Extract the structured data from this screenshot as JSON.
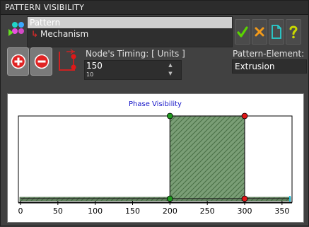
{
  "window": {
    "title": "PATTERN VISIBILITY"
  },
  "tree": {
    "items": [
      {
        "label": "Pattern"
      },
      {
        "label": "Mechanism"
      }
    ]
  },
  "toolbar": {
    "ok_icon": "check-icon",
    "cancel_icon": "x-icon",
    "new_icon": "document-icon",
    "help_icon": "question-icon",
    "ok_color": "#5ad400",
    "cancel_color": "#f29a1a",
    "new_color": "#28d0d0",
    "help_color": "#c8d800"
  },
  "timing": {
    "label": "Node's Timing: [ Units ]",
    "value": "150",
    "step": "10"
  },
  "pattern_element": {
    "label": "Pattern-Element:",
    "value": "Extrusion"
  },
  "chart_data": {
    "type": "area",
    "title": "Phase Visibility",
    "x_ticks": [
      0,
      50,
      100,
      150,
      200,
      250,
      300,
      350
    ],
    "xlim": [
      0,
      360
    ],
    "ylim": [
      0,
      1
    ],
    "series": [
      {
        "points": [
          [
            0,
            0
          ],
          [
            200,
            0
          ],
          [
            200,
            1
          ],
          [
            300,
            1
          ],
          [
            300,
            0
          ],
          [
            360,
            0
          ]
        ]
      }
    ],
    "fill": "#5e8a5a",
    "start_marker_color": "#1e9a1e",
    "end_marker_color": "#e01818"
  }
}
